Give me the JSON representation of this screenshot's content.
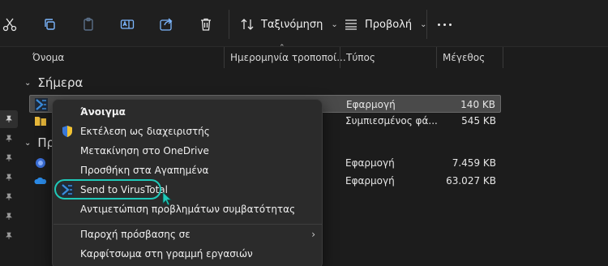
{
  "toolbar": {
    "sort_label": "Ταξινόμηση",
    "view_label": "Προβολή",
    "icons": [
      "cut-icon",
      "copy-icon",
      "paste-icon",
      "rename-icon",
      "share-icon",
      "delete-icon",
      "sort-icon",
      "view-icon",
      "more-icon"
    ]
  },
  "columns": {
    "name": "Όνομα",
    "date": "Ημερομηνία τροποποί...",
    "type": "Τύπος",
    "size": "Μέγεθος"
  },
  "groups": {
    "today": "Σήμερα",
    "earlier_partial": "Πρ"
  },
  "rows": [
    {
      "type": "Εφαρμογή",
      "size": "140 KB",
      "selected": true
    },
    {
      "type": "Συμπιεσμένος φά...",
      "size": "545 KB",
      "selected": false
    },
    {
      "type": "Εφαρμογή",
      "size": "7.459 KB",
      "selected": false
    },
    {
      "type": "Εφαρμογή",
      "size": "63.027 KB",
      "selected": false
    }
  ],
  "context_menu": {
    "items": [
      {
        "label": "Άνοιγμα",
        "icon": "none"
      },
      {
        "label": "Εκτέλεση ως διαχειριστής",
        "icon": "uac-shield-icon"
      },
      {
        "label": "Μετακίνηση στο OneDrive",
        "icon": "none"
      },
      {
        "label": "Προσθήκη στα Αγαπημένα",
        "icon": "none"
      },
      {
        "label": "Send to VirusTotal",
        "icon": "virustotal-icon"
      },
      {
        "label": "Αντιμετώπιση προβλημάτων συμβατότητας",
        "icon": "none"
      },
      {
        "label": "Παροχή πρόσβασης σε",
        "icon": "none"
      },
      {
        "label": "Καρφίτσωμα στη γραμμή εργασιών",
        "icon": "none"
      }
    ],
    "submenu_arrow": "›"
  },
  "colors": {
    "background": "#1c1c1c",
    "menu_bg": "#2b2b2b",
    "highlight_ring": "#1fc8b8",
    "selected_row": "#4a4a4a"
  }
}
